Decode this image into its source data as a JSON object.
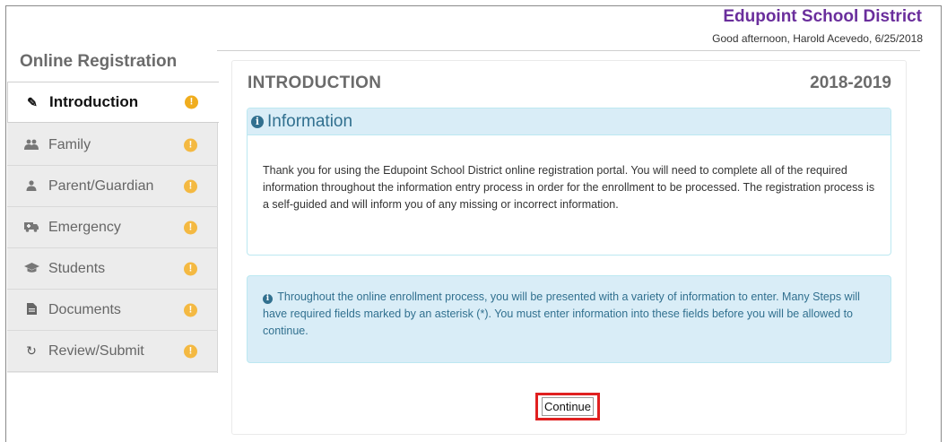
{
  "header": {
    "district": "Edupoint School District",
    "greeting": "Good afternoon, Harold Acevedo, 6/25/2018"
  },
  "sidebar": {
    "title": "Online Registration",
    "items": [
      {
        "label": "Introduction",
        "icon": "pencil-icon",
        "active": true
      },
      {
        "label": "Family",
        "icon": "users-icon"
      },
      {
        "label": "Parent/Guardian",
        "icon": "user-icon"
      },
      {
        "label": "Emergency",
        "icon": "ambulance-icon"
      },
      {
        "label": "Students",
        "icon": "graduation-cap-icon"
      },
      {
        "label": "Documents",
        "icon": "file-icon"
      },
      {
        "label": "Review/Submit",
        "icon": "refresh-icon"
      }
    ],
    "warning_glyph": "!"
  },
  "main": {
    "title": "INTRODUCTION",
    "year": "2018-2019",
    "info": {
      "heading": "Information",
      "body": "Thank you for using the Edupoint School District online registration portal. You will need to complete all of the required information throughout the information entry process in order for the enrollment to be processed. The registration process is a self-guided and will inform you of any missing or incorrect information."
    },
    "alert": {
      "text": "Throughout the online enrollment process, you will be presented with a variety of information to enter. Many Steps will have required fields marked by an asterisk (*). You must enter information into these fields before you will be allowed to continue."
    },
    "continue_label": "Continue"
  },
  "colors": {
    "district": "#6a2e9c",
    "info_text": "#31708f",
    "info_bg": "#d9edf7",
    "warning": "#f4b942",
    "highlight": "#e02020"
  }
}
